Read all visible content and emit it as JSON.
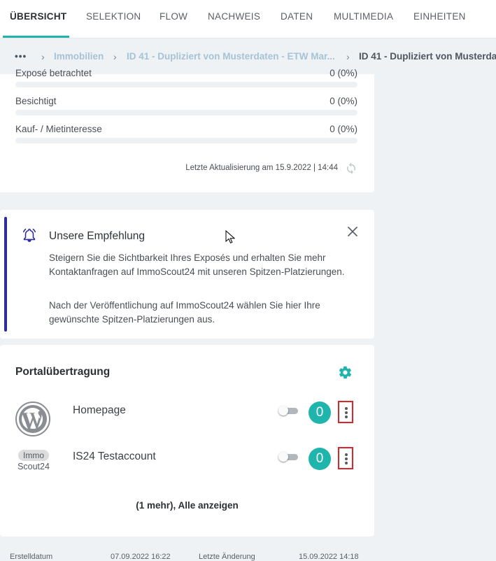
{
  "tabs": [
    {
      "label": "ÜBERSICHT",
      "active": true
    },
    {
      "label": "SELEKTION"
    },
    {
      "label": "FLOW"
    },
    {
      "label": "NACHWEIS"
    },
    {
      "label": "DATEN"
    },
    {
      "label": "MULTIMEDIA"
    },
    {
      "label": "EINHEITEN"
    }
  ],
  "breadcrumb": {
    "more": "•••",
    "items": [
      "Immobilien",
      "ID 41 - Dupliziert von Musterdaten - ETW Mar...",
      "ID 41 - Dupliziert von Musterda"
    ]
  },
  "stats": {
    "rows": [
      {
        "label": "Exposé betrachtet",
        "value": "0 (0%)"
      },
      {
        "label": "Besichtigt",
        "value": "0 (0%)"
      },
      {
        "label": "Kauf- / Mietinteresse",
        "value": "0 (0%)"
      }
    ],
    "updated": "Letzte Aktualisierung am 15.9.2022 | 14:44"
  },
  "tip": {
    "title": "Unsere Empfehlung",
    "paragraph1": "Steigern Sie die Sichtbarkeit Ihres Exposés und erhalten Sie mehr Kontaktanfragen auf ImmoScout24 mit unseren Spitzen-Platzierungen.",
    "paragraph2": "Nach der Veröffentlichung auf ImmoScout24 wählen Sie hier Ihre gewünschte Spitzen-Platzierungen aus."
  },
  "portal": {
    "title": "Portalübertragung",
    "items": [
      {
        "name": "Homepage",
        "count": "0",
        "enabled": false,
        "logo": "wordpress-logo"
      },
      {
        "name": "IS24 Testaccount",
        "count": "0",
        "enabled": false,
        "logo": "immoscout24-logo",
        "logo_text_top": "Immo",
        "logo_text_bottom": "Scout24"
      }
    ],
    "show_all": "(1 mehr), Alle anzeigen"
  },
  "footer": {
    "created_label": "Erstelldatum",
    "created_value": "07.09.2022 16:22",
    "changed_label": "Letzte Änderung",
    "changed_value": "15.09.2022 14:18"
  },
  "colors": {
    "accent": "#1fb5ad",
    "tip_border": "#2c2c9c",
    "highlight": "#d9262c"
  }
}
